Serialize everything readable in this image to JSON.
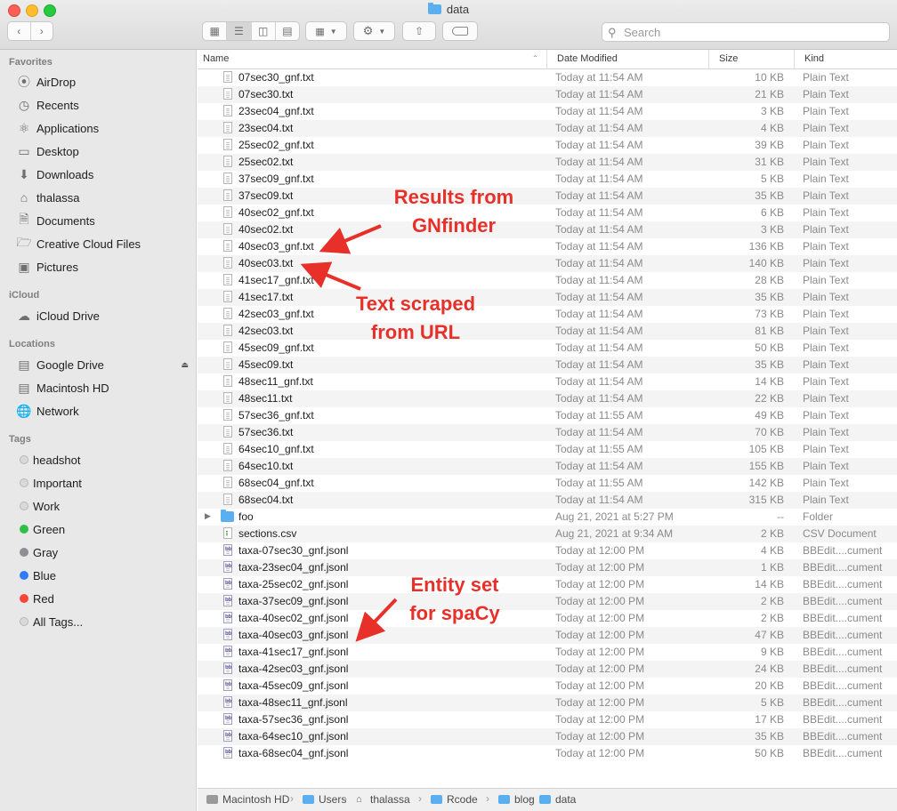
{
  "window": {
    "title": "data"
  },
  "toolbar": {
    "view_icons": [
      "icon-view-icon",
      "list-view-icon",
      "column-view-icon",
      "gallery-view-icon"
    ],
    "search_placeholder": "Search"
  },
  "sidebar": {
    "favorites_header": "Favorites",
    "favorites": [
      {
        "label": "AirDrop",
        "icon": "airdrop-icon"
      },
      {
        "label": "Recents",
        "icon": "clock-icon"
      },
      {
        "label": "Applications",
        "icon": "applications-icon"
      },
      {
        "label": "Desktop",
        "icon": "desktop-icon"
      },
      {
        "label": "Downloads",
        "icon": "downloads-icon"
      },
      {
        "label": "thalassa",
        "icon": "home-icon"
      },
      {
        "label": "Documents",
        "icon": "document-icon"
      },
      {
        "label": "Creative Cloud Files",
        "icon": "folder-icon"
      },
      {
        "label": "Pictures",
        "icon": "camera-icon"
      }
    ],
    "icloud_header": "iCloud",
    "icloud": [
      {
        "label": "iCloud Drive",
        "icon": "cloud-icon"
      }
    ],
    "locations_header": "Locations",
    "locations": [
      {
        "label": "Google Drive",
        "icon": "drive-icon"
      },
      {
        "label": "Macintosh HD",
        "icon": "harddisk-icon"
      },
      {
        "label": "Network",
        "icon": "globe-icon"
      }
    ],
    "tags_header": "Tags",
    "tags": [
      {
        "label": "headshot",
        "color": "#d9d9d9"
      },
      {
        "label": "Important",
        "color": "#d9d9d9"
      },
      {
        "label": "Work",
        "color": "#d9d9d9"
      },
      {
        "label": "Green",
        "color": "#30c048"
      },
      {
        "label": "Gray",
        "color": "#8e8e93"
      },
      {
        "label": "Blue",
        "color": "#2f7cf6"
      },
      {
        "label": "Red",
        "color": "#f7453c"
      },
      {
        "label": "All Tags...",
        "color": "#d9d9d9"
      }
    ]
  },
  "columns": {
    "name": "Name",
    "date": "Date Modified",
    "size": "Size",
    "kind": "Kind"
  },
  "files": [
    {
      "name": "07sec30_gnf.txt",
      "date": "Today at 11:54 AM",
      "size": "10 KB",
      "kind": "Plain Text",
      "type": "txt"
    },
    {
      "name": "07sec30.txt",
      "date": "Today at 11:54 AM",
      "size": "21 KB",
      "kind": "Plain Text",
      "type": "txt"
    },
    {
      "name": "23sec04_gnf.txt",
      "date": "Today at 11:54 AM",
      "size": "3 KB",
      "kind": "Plain Text",
      "type": "txt"
    },
    {
      "name": "23sec04.txt",
      "date": "Today at 11:54 AM",
      "size": "4 KB",
      "kind": "Plain Text",
      "type": "txt"
    },
    {
      "name": "25sec02_gnf.txt",
      "date": "Today at 11:54 AM",
      "size": "39 KB",
      "kind": "Plain Text",
      "type": "txt"
    },
    {
      "name": "25sec02.txt",
      "date": "Today at 11:54 AM",
      "size": "31 KB",
      "kind": "Plain Text",
      "type": "txt"
    },
    {
      "name": "37sec09_gnf.txt",
      "date": "Today at 11:54 AM",
      "size": "5 KB",
      "kind": "Plain Text",
      "type": "txt"
    },
    {
      "name": "37sec09.txt",
      "date": "Today at 11:54 AM",
      "size": "35 KB",
      "kind": "Plain Text",
      "type": "txt"
    },
    {
      "name": "40sec02_gnf.txt",
      "date": "Today at 11:54 AM",
      "size": "6 KB",
      "kind": "Plain Text",
      "type": "txt"
    },
    {
      "name": "40sec02.txt",
      "date": "Today at 11:54 AM",
      "size": "3 KB",
      "kind": "Plain Text",
      "type": "txt"
    },
    {
      "name": "40sec03_gnf.txt",
      "date": "Today at 11:54 AM",
      "size": "136 KB",
      "kind": "Plain Text",
      "type": "txt"
    },
    {
      "name": "40sec03.txt",
      "date": "Today at 11:54 AM",
      "size": "140 KB",
      "kind": "Plain Text",
      "type": "txt"
    },
    {
      "name": "41sec17_gnf.txt",
      "date": "Today at 11:54 AM",
      "size": "28 KB",
      "kind": "Plain Text",
      "type": "txt"
    },
    {
      "name": "41sec17.txt",
      "date": "Today at 11:54 AM",
      "size": "35 KB",
      "kind": "Plain Text",
      "type": "txt"
    },
    {
      "name": "42sec03_gnf.txt",
      "date": "Today at 11:54 AM",
      "size": "73 KB",
      "kind": "Plain Text",
      "type": "txt"
    },
    {
      "name": "42sec03.txt",
      "date": "Today at 11:54 AM",
      "size": "81 KB",
      "kind": "Plain Text",
      "type": "txt"
    },
    {
      "name": "45sec09_gnf.txt",
      "date": "Today at 11:54 AM",
      "size": "50 KB",
      "kind": "Plain Text",
      "type": "txt"
    },
    {
      "name": "45sec09.txt",
      "date": "Today at 11:54 AM",
      "size": "35 KB",
      "kind": "Plain Text",
      "type": "txt"
    },
    {
      "name": "48sec11_gnf.txt",
      "date": "Today at 11:54 AM",
      "size": "14 KB",
      "kind": "Plain Text",
      "type": "txt"
    },
    {
      "name": "48sec11.txt",
      "date": "Today at 11:54 AM",
      "size": "22 KB",
      "kind": "Plain Text",
      "type": "txt"
    },
    {
      "name": "57sec36_gnf.txt",
      "date": "Today at 11:55 AM",
      "size": "49 KB",
      "kind": "Plain Text",
      "type": "txt"
    },
    {
      "name": "57sec36.txt",
      "date": "Today at 11:54 AM",
      "size": "70 KB",
      "kind": "Plain Text",
      "type": "txt"
    },
    {
      "name": "64sec10_gnf.txt",
      "date": "Today at 11:55 AM",
      "size": "105 KB",
      "kind": "Plain Text",
      "type": "txt"
    },
    {
      "name": "64sec10.txt",
      "date": "Today at 11:54 AM",
      "size": "155 KB",
      "kind": "Plain Text",
      "type": "txt"
    },
    {
      "name": "68sec04_gnf.txt",
      "date": "Today at 11:55 AM",
      "size": "142 KB",
      "kind": "Plain Text",
      "type": "txt"
    },
    {
      "name": "68sec04.txt",
      "date": "Today at 11:54 AM",
      "size": "315 KB",
      "kind": "Plain Text",
      "type": "txt"
    },
    {
      "name": "foo",
      "date": "Aug 21, 2021 at 5:27 PM",
      "size": "--",
      "kind": "Folder",
      "type": "folder"
    },
    {
      "name": "sections.csv",
      "date": "Aug 21, 2021 at 9:34 AM",
      "size": "2 KB",
      "kind": "CSV Document",
      "type": "csv"
    },
    {
      "name": "taxa-07sec30_gnf.jsonl",
      "date": "Today at 12:00 PM",
      "size": "4 KB",
      "kind": "BBEdit....cument",
      "type": "json"
    },
    {
      "name": "taxa-23sec04_gnf.jsonl",
      "date": "Today at 12:00 PM",
      "size": "1 KB",
      "kind": "BBEdit....cument",
      "type": "json"
    },
    {
      "name": "taxa-25sec02_gnf.jsonl",
      "date": "Today at 12:00 PM",
      "size": "14 KB",
      "kind": "BBEdit....cument",
      "type": "json"
    },
    {
      "name": "taxa-37sec09_gnf.jsonl",
      "date": "Today at 12:00 PM",
      "size": "2 KB",
      "kind": "BBEdit....cument",
      "type": "json"
    },
    {
      "name": "taxa-40sec02_gnf.jsonl",
      "date": "Today at 12:00 PM",
      "size": "2 KB",
      "kind": "BBEdit....cument",
      "type": "json"
    },
    {
      "name": "taxa-40sec03_gnf.jsonl",
      "date": "Today at 12:00 PM",
      "size": "47 KB",
      "kind": "BBEdit....cument",
      "type": "json"
    },
    {
      "name": "taxa-41sec17_gnf.jsonl",
      "date": "Today at 12:00 PM",
      "size": "9 KB",
      "kind": "BBEdit....cument",
      "type": "json"
    },
    {
      "name": "taxa-42sec03_gnf.jsonl",
      "date": "Today at 12:00 PM",
      "size": "24 KB",
      "kind": "BBEdit....cument",
      "type": "json"
    },
    {
      "name": "taxa-45sec09_gnf.jsonl",
      "date": "Today at 12:00 PM",
      "size": "20 KB",
      "kind": "BBEdit....cument",
      "type": "json"
    },
    {
      "name": "taxa-48sec11_gnf.jsonl",
      "date": "Today at 12:00 PM",
      "size": "5 KB",
      "kind": "BBEdit....cument",
      "type": "json"
    },
    {
      "name": "taxa-57sec36_gnf.jsonl",
      "date": "Today at 12:00 PM",
      "size": "17 KB",
      "kind": "BBEdit....cument",
      "type": "json"
    },
    {
      "name": "taxa-64sec10_gnf.jsonl",
      "date": "Today at 12:00 PM",
      "size": "35 KB",
      "kind": "BBEdit....cument",
      "type": "json"
    },
    {
      "name": "taxa-68sec04_gnf.jsonl",
      "date": "Today at 12:00 PM",
      "size": "50 KB",
      "kind": "BBEdit....cument",
      "type": "json"
    }
  ],
  "pathbar": [
    "Macintosh HD",
    "Users",
    "thalassa",
    "Rcode",
    "blog",
    "data"
  ],
  "annotations": {
    "gnfinder_line1": "Results from",
    "gnfinder_line2": "GNfinder",
    "scraped_line1": "Text scraped",
    "scraped_line2": "from URL",
    "entity_line1": "Entity set",
    "entity_line2": "for spaCy",
    "color": "#e8302a"
  }
}
